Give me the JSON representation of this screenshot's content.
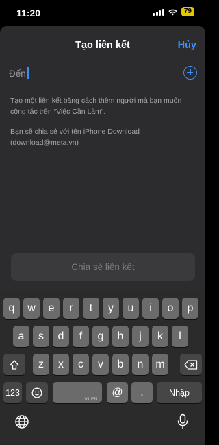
{
  "status_bar": {
    "time": "11:20",
    "battery": "79"
  },
  "sheet": {
    "title": "Tạo liên kết",
    "cancel": "Hủy",
    "to_label": "Đến:",
    "to_value": "",
    "info_line_1": "Tạo một liên kết bằng cách thêm người mà bạn muốn cộng tác trên “Việc Cần Làm”.",
    "info_line_2": "Bạn sẽ chia sẻ với tên iPhone Download (download@meta.vn)",
    "share_button": "Chia sẻ liên kết"
  },
  "keyboard": {
    "row1": [
      "q",
      "w",
      "e",
      "r",
      "t",
      "y",
      "u",
      "i",
      "o",
      "p"
    ],
    "row2": [
      "a",
      "s",
      "d",
      "f",
      "g",
      "h",
      "j",
      "k",
      "l"
    ],
    "row3": [
      "z",
      "x",
      "c",
      "v",
      "b",
      "n",
      "m"
    ],
    "numbers_key": "123",
    "space_sub": "VI EN",
    "at_key": "@",
    "dot_key": ".",
    "return_key": "Nhập"
  },
  "icons": {
    "shift": "shift-icon",
    "backspace": "backspace-icon",
    "emoji": "emoji-icon",
    "globe": "globe-icon",
    "mic": "microphone-icon",
    "add": "add-contact-icon",
    "wifi": "wifi-icon",
    "signal": "cellular-signal-icon"
  },
  "colors": {
    "accent": "#3d8ef7",
    "battery": "#e5c600"
  }
}
